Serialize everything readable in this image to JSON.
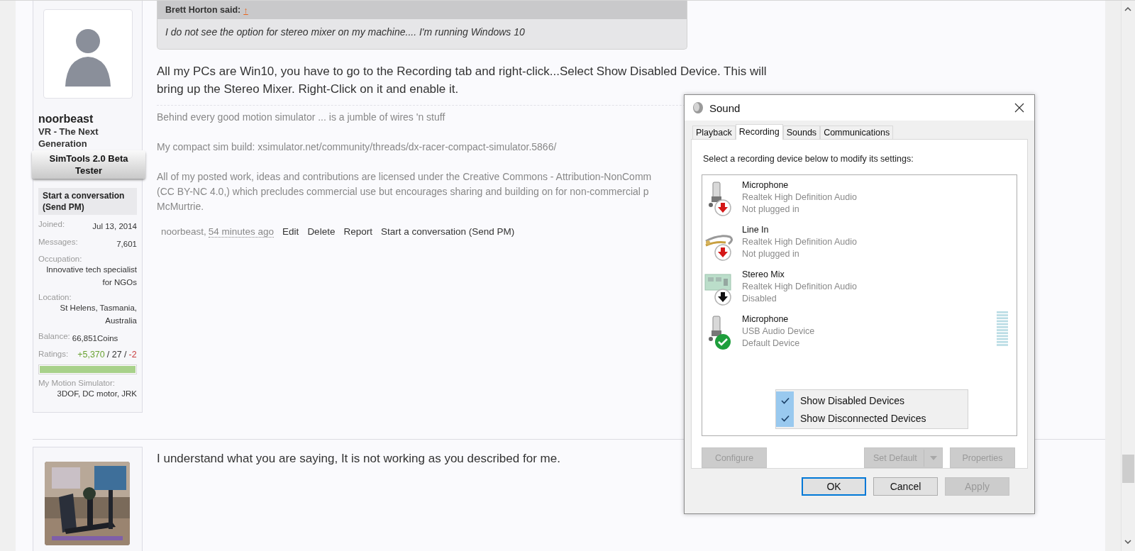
{
  "posts": [
    {
      "user": {
        "name": "noorbeast",
        "title": "VR - The Next Generation",
        "banner": "SimTools 2.0 Beta Tester",
        "send_pm": "Start a conversation (Send PM)",
        "stats": [
          {
            "kind": "row",
            "label": "Joined:",
            "value": "Jul 13, 2014"
          },
          {
            "kind": "row",
            "label": "Messages:",
            "value": "7,601"
          },
          {
            "kind": "block",
            "label": "Occupation:",
            "value": "Innovative tech specialist for NGOs"
          },
          {
            "kind": "block",
            "label": "Location:",
            "value": "St Helens, Tasmania, Australia"
          },
          {
            "kind": "inline",
            "label": "Balance:",
            "value": "66,851Coins"
          }
        ],
        "ratings": {
          "label": "Ratings:",
          "parts": [
            {
              "text": "+5,370",
              "color": "#6aa333"
            },
            {
              "text": "/ 27 /",
              "color": "#333333"
            },
            {
              "text": "-2",
              "color": "#c83c3c"
            }
          ]
        },
        "rating_bar": {
          "level": 1
        },
        "extra": [
          {
            "kind": "block",
            "label": "My Motion Simulator:",
            "value": "3DOF, DC motor, JRK"
          }
        ]
      },
      "quote": {
        "author": "Brett Horton said:",
        "link": "↑",
        "text": "I do not see the option for stereo mixer on my machine.... I'm running Windows 10"
      },
      "message": "All my PCs are Win10, you have to go to the Recording tab and right-click...Select Show Disabled Device. This will bring up the Stereo Mixer. Right-Click on it and enable it.",
      "signature": [
        [
          "Behind every good motion simulator ... is a jumble of wires 'n stuff"
        ],
        [
          "My compact sim build: xsimulator.net/community/threads/dx-racer-compact-simulator.5866/"
        ],
        [
          "All of my posted work, ideas and contributions are licensed under the Creative Commons - Attribution-NonComm",
          "(CC BY-NC 4.0,) which precludes commercial use but encourages sharing and building on for non-commercial p",
          "McMurtrie."
        ]
      ],
      "footer": {
        "author": "noorbeast,",
        "time": "54 minutes ago",
        "actions": [
          "Edit",
          "Delete",
          "Report",
          "Start a conversation (Send PM)"
        ]
      }
    },
    {
      "message": "I understand what you are saying, It is not working as you described for me."
    }
  ],
  "dialog": {
    "title": "Sound",
    "tabs": [
      {
        "label": "Playback",
        "selected": false
      },
      {
        "label": "Recording",
        "selected": true
      },
      {
        "label": "Sounds",
        "selected": false
      },
      {
        "label": "Communications",
        "selected": false
      }
    ],
    "instruction": "Select a recording device below to modify its settings:",
    "devices": [
      {
        "kind": "microphone",
        "name": "Microphone",
        "driver": "Realtek High Definition Audio",
        "status": "Not plugged in",
        "plugged_in": false,
        "enabled": true,
        "default": false
      },
      {
        "kind": "line",
        "name": "Line In",
        "driver": "Realtek High Definition Audio",
        "status": "Not plugged in",
        "plugged_in": false,
        "enabled": true,
        "default": false
      },
      {
        "kind": "card",
        "name": "Stereo Mix",
        "driver": "Realtek High Definition Audio",
        "status": "Disabled",
        "plugged_in": true,
        "enabled": false,
        "default": false
      },
      {
        "kind": "microphone",
        "name": "Microphone",
        "driver": "USB Audio Device",
        "status": "Default Device",
        "plugged_in": true,
        "enabled": true,
        "default": true
      }
    ],
    "menu": [
      {
        "label": "Show Disabled Devices",
        "checked": true
      },
      {
        "label": "Show Disconnected Devices",
        "checked": true
      }
    ],
    "panel_buttons": [
      {
        "label": "Configure",
        "disabled": true,
        "kind": "plain"
      },
      {
        "label": "Set Default",
        "disabled": true,
        "kind": "split"
      },
      {
        "label": "Properties",
        "disabled": true,
        "kind": "plain"
      }
    ],
    "buttons": [
      {
        "label": "OK",
        "disabled": false,
        "default": true
      },
      {
        "label": "Cancel",
        "disabled": false,
        "default": false
      },
      {
        "label": "Apply",
        "disabled": true,
        "default": false
      }
    ]
  }
}
